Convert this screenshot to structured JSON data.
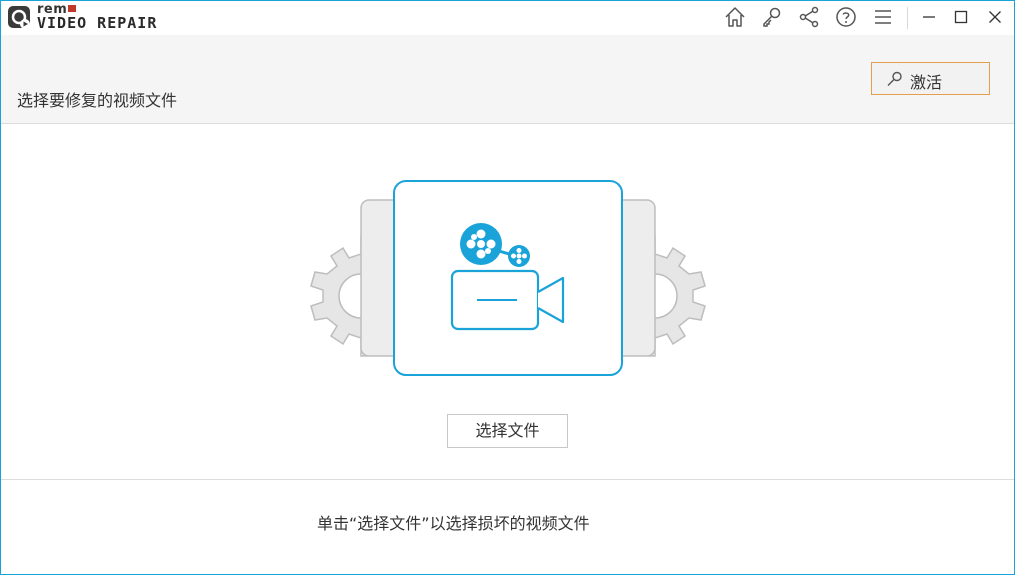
{
  "app": {
    "logo_small": "rem",
    "logo_product": "VIDEO REPAIR"
  },
  "titlebar": {
    "icons": [
      "home-icon",
      "key-icon",
      "share-icon",
      "help-icon",
      "menu-icon",
      "minimize-icon",
      "maximize-icon",
      "close-icon"
    ]
  },
  "header": {
    "title": "选择要修复的视频文件",
    "activate_label": "激活"
  },
  "main": {
    "select_file_label": "选择文件"
  },
  "footer": {
    "hint": "单击“选择文件”以选择损坏的视频文件"
  },
  "colors": {
    "accent": "#1aa3d9",
    "activate_border": "#e0a050",
    "gear": "#e6e6e6"
  }
}
